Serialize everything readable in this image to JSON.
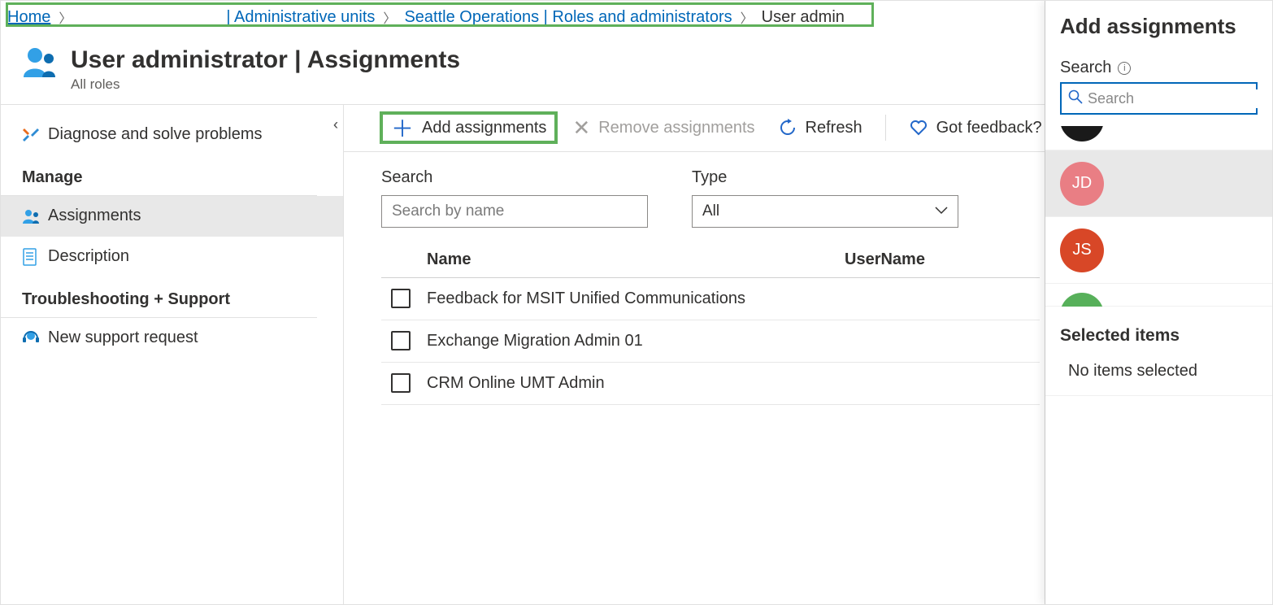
{
  "breadcrumb": {
    "items": [
      {
        "label": "Home"
      },
      {
        "label": "| Administrative units"
      },
      {
        "label": "Seattle Operations | Roles and administrators"
      }
    ],
    "current": "User admin"
  },
  "header": {
    "title": "User administrator | Assignments",
    "subtitle": "All roles"
  },
  "sidebar": {
    "diagnose_label": "Diagnose and solve problems",
    "manage_heading": "Manage",
    "assignments_label": "Assignments",
    "description_label": "Description",
    "troubleshoot_heading": "Troubleshooting + Support",
    "support_label": "New support request"
  },
  "toolbar": {
    "add_label": "Add assignments",
    "remove_label": "Remove assignments",
    "refresh_label": "Refresh",
    "feedback_label": "Got feedback?"
  },
  "filters": {
    "search_label": "Search",
    "search_placeholder": "Search by name",
    "type_label": "Type",
    "type_value": "All"
  },
  "table": {
    "col_name": "Name",
    "col_user": "UserName",
    "rows": [
      {
        "name": "Feedback for MSIT Unified Communications"
      },
      {
        "name": "Exchange Migration Admin 01"
      },
      {
        "name": "CRM Online UMT Admin"
      }
    ]
  },
  "panel": {
    "title": "Add assignments",
    "search_label": "Search",
    "search_placeholder": "Search",
    "candidates": [
      {
        "initials": "JD",
        "color": "#e97e84",
        "selected": true
      },
      {
        "initials": "JS",
        "color": "#d84727",
        "selected": false
      }
    ],
    "partial_color": "#57b05a",
    "selected_heading": "Selected items",
    "empty_text": "No items selected"
  }
}
